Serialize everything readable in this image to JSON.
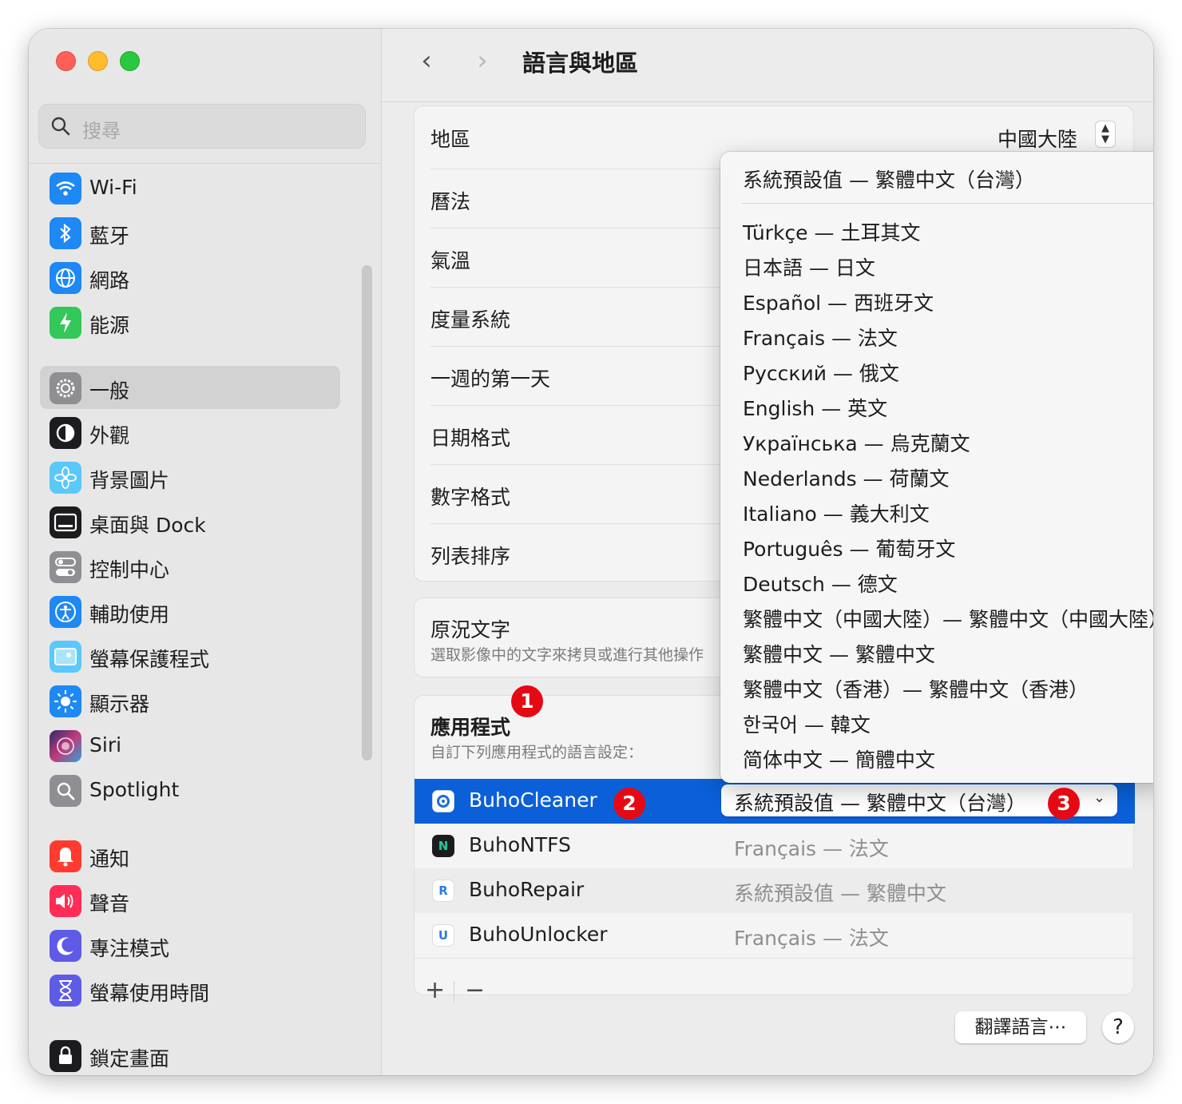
{
  "sidebar": {
    "search_placeholder": "搜尋",
    "items": [
      {
        "label": "Wi-Fi",
        "icon": "wifi-icon",
        "color": "#1e88f4"
      },
      {
        "label": "藍牙",
        "icon": "bluetooth-icon",
        "color": "#1e88f4"
      },
      {
        "label": "網路",
        "icon": "globe-icon",
        "color": "#1e88f4"
      },
      {
        "label": "能源",
        "icon": "battery-bolt-icon",
        "color": "#34c759"
      },
      {
        "label": "一般",
        "icon": "gear-icon",
        "color": "#8e8e93"
      },
      {
        "label": "外觀",
        "icon": "appearance-icon",
        "color": "#1c1c1e"
      },
      {
        "label": "背景圖片",
        "icon": "flower-icon",
        "color": "#5ac8fa"
      },
      {
        "label": "桌面與 Dock",
        "icon": "dock-icon",
        "color": "#1c1c1e"
      },
      {
        "label": "控制中心",
        "icon": "toggles-icon",
        "color": "#8e8e93"
      },
      {
        "label": "輔助使用",
        "icon": "accessibility-icon",
        "color": "#1e88f4"
      },
      {
        "label": "螢幕保護程式",
        "icon": "screensaver-icon",
        "color": "#5ac8fa"
      },
      {
        "label": "顯示器",
        "icon": "sun-icon",
        "color": "#1e88f4"
      },
      {
        "label": "Siri",
        "icon": "siri-icon",
        "color": "#6b3fa0"
      },
      {
        "label": "Spotlight",
        "icon": "spotlight-icon",
        "color": "#8e8e93"
      },
      {
        "label": "通知",
        "icon": "bell-icon",
        "color": "#ff3b30"
      },
      {
        "label": "聲音",
        "icon": "speaker-icon",
        "color": "#ff2d55"
      },
      {
        "label": "專注模式",
        "icon": "moon-icon",
        "color": "#5e5ce6"
      },
      {
        "label": "螢幕使用時間",
        "icon": "hourglass-icon",
        "color": "#5e5ce6"
      },
      {
        "label": "鎖定畫面",
        "icon": "lock-icon",
        "color": "#1c1c1e"
      }
    ]
  },
  "header": {
    "back_glyph": "‹",
    "forward_glyph": "›",
    "title": "語言與地區"
  },
  "settings": {
    "region_label": "地區",
    "region_value": "中國大陸",
    "rows": [
      "曆法",
      "氣溫",
      "度量系統",
      "一週的第一天",
      "日期格式",
      "數字格式",
      "列表排序"
    ]
  },
  "live_text": {
    "title": "原況文字",
    "subtitle": "選取影像中的文字來拷貝或進行其他操作"
  },
  "apps_section": {
    "title": "應用程式",
    "subtitle": "自訂下列應用程式的語言設定：",
    "apps": [
      {
        "name": "BuhoCleaner",
        "language": "系統預設值 — 繁體中文（台灣）",
        "icon": "buhocleaner-icon"
      },
      {
        "name": "BuhoNTFS",
        "language": "Français — 法文",
        "icon": "buhontfs-icon"
      },
      {
        "name": "BuhoRepair",
        "language": "系統預設值 — 繁體中文",
        "icon": "buhorepair-icon"
      },
      {
        "name": "BuhoUnlocker",
        "language": "Français — 法文",
        "icon": "buhounlocker-icon"
      }
    ],
    "add_label": "+",
    "remove_label": "−"
  },
  "footer": {
    "translate_label": "翻譯語言⋯",
    "help_label": "?"
  },
  "dropdown": {
    "default_item": "系統預設值 — 繁體中文（台灣）",
    "items": [
      "Türkçe — 土耳其文",
      "日本語 — 日文",
      "Español — 西班牙文",
      "Français — 法文",
      "Русский — 俄文",
      "English — 英文",
      "Українська — 烏克蘭文",
      "Nederlands — 荷蘭文",
      "Italiano — 義大利文",
      "Português — 葡萄牙文",
      "Deutsch — 德文",
      "繁體中文（中國大陸）— 繁體中文（中國大陸）",
      "繁體中文 — 繁體中文",
      "繁體中文（香港）— 繁體中文（香港）",
      "한국어 — 韓文",
      "简体中文 — 簡體中文"
    ]
  },
  "annotations": {
    "badge_1": "1",
    "badge_2": "2",
    "badge_3": "3",
    "color": "#e50914"
  },
  "colors": {
    "selection_blue": "#0b5fd8",
    "sidebar_bg": "#e8e7e8"
  }
}
